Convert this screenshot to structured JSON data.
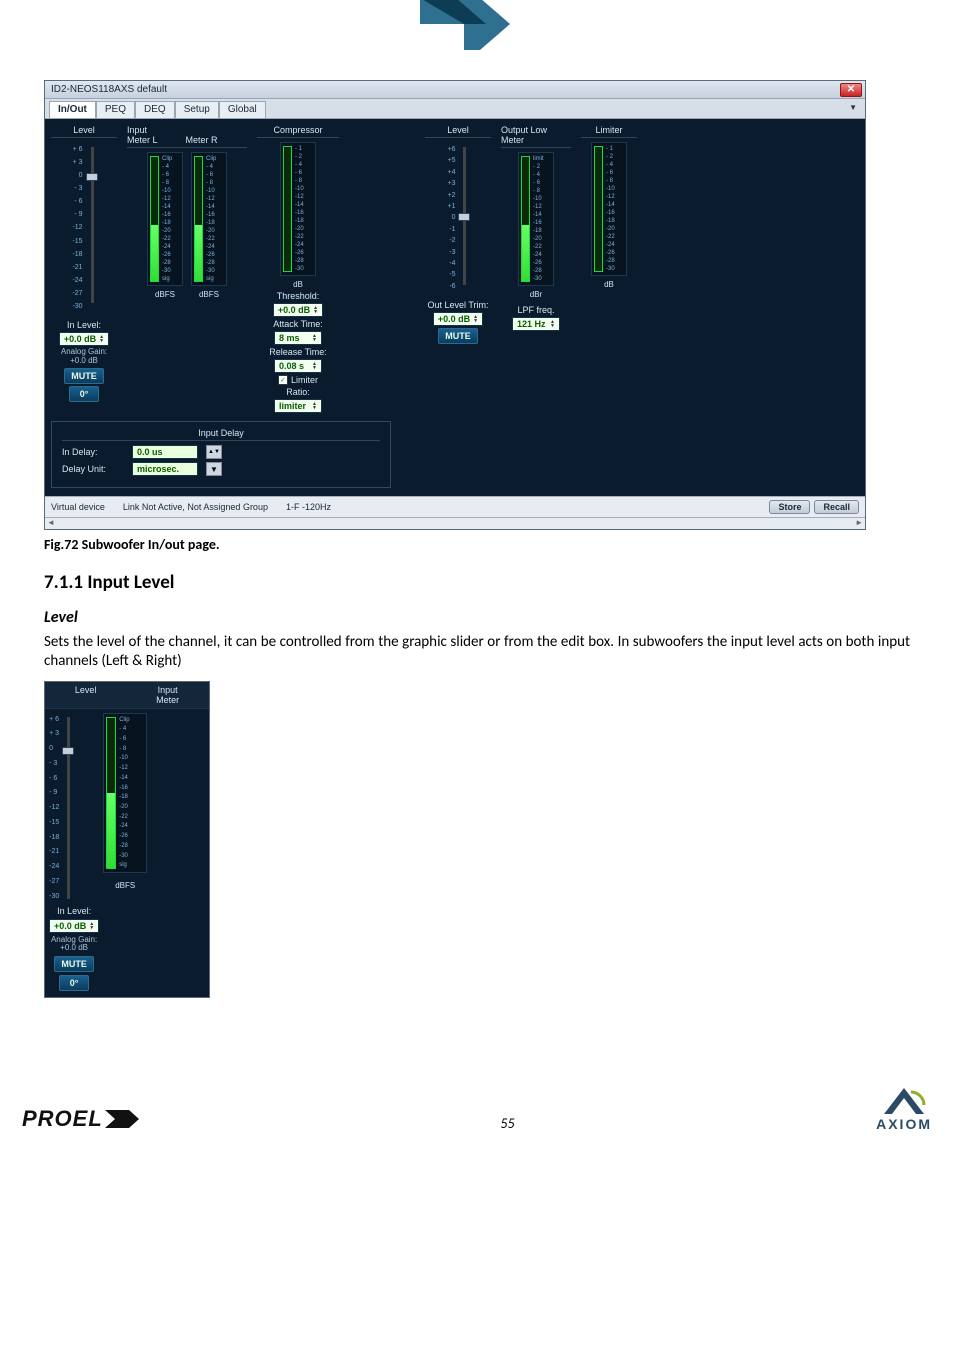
{
  "windowTitle": "ID2-NEOS118AXS default",
  "tabs": [
    "In/Out",
    "PEQ",
    "DEQ",
    "Setup",
    "Global"
  ],
  "activeTab": "In/Out",
  "input": {
    "sectionHeaders": {
      "level": "Level",
      "meter": "Input",
      "meterL": "Meter L",
      "meterR": "Meter R",
      "compressor": "Compressor"
    },
    "levelScale": [
      "+ 6",
      "+ 3",
      "0",
      "- 3",
      "- 6",
      "- 9",
      "-12",
      "-15",
      "-18",
      "-21",
      "-24",
      "-27",
      "-30"
    ],
    "meterScale": [
      "Clip",
      "- 4",
      "- 6",
      "- 8",
      "-10",
      "-12",
      "-14",
      "-16",
      "-18",
      "-20",
      "-22",
      "-24",
      "-26",
      "-28",
      "-30",
      "sig"
    ],
    "meterUnit": "dBFS",
    "compScale": [
      "- 1",
      "- 2",
      "- 4",
      "- 6",
      "- 8",
      "-10",
      "-12",
      "-14",
      "-16",
      "-18",
      "-20",
      "-22",
      "-24",
      "-26",
      "-28",
      "-30"
    ],
    "compUnit": "dB",
    "inLevelLbl": "In Level:",
    "inLevelVal": "+0.0 dB",
    "analogGainLbl": "Analog Gain:",
    "analogGainVal": "+0.0 dB",
    "muteBtn": "MUTE",
    "phaseBtn": "0°",
    "compressor": {
      "thLbl": "Threshold:",
      "thVal": "+0.0 dB",
      "atLbl": "Attack Time:",
      "atVal": "8 ms",
      "rlLbl": "Release Time:",
      "rlVal": "0.08 s",
      "limChk": "Limiter",
      "limChecked": true,
      "raLbl": "Ratio:",
      "raVal": "limiter"
    }
  },
  "inputDelay": {
    "title": "Input Delay",
    "inDelayLbl": "In Delay:",
    "inDelayVal": "0.0 us",
    "unitLbl": "Delay Unit:",
    "unitVal": "microsec."
  },
  "output": {
    "sectionHeaders": {
      "level": "Level",
      "meter": "Output Low",
      "meterSub": "Meter",
      "limiter": "Limiter"
    },
    "levelScale": [
      "+6",
      "+5",
      "+4",
      "+3",
      "+2",
      "+1",
      "0",
      "-1",
      "-2",
      "-3",
      "-4",
      "-5",
      "-6"
    ],
    "meterScale": [
      "limit",
      "- 2",
      "- 4",
      "- 6",
      "- 8",
      "-10",
      "-12",
      "-14",
      "-16",
      "-18",
      "-20",
      "-22",
      "-24",
      "-26",
      "-28",
      "-30"
    ],
    "meterUnit": "dBr",
    "limScale": [
      "- 1",
      "- 2",
      "- 4",
      "- 6",
      "- 8",
      "-10",
      "-12",
      "-14",
      "-16",
      "-18",
      "-20",
      "-22",
      "-24",
      "-26",
      "-28",
      "-30"
    ],
    "limUnit": "dB",
    "outTrimLbl": "Out Level Trim:",
    "outTrimVal": "+0.0 dB",
    "muteBtn": "MUTE",
    "lpfLbl": "LPF freq.",
    "lpfVal": "121 Hz"
  },
  "status": {
    "device": "Virtual device",
    "link": "Link Not Active,  Not Assigned Group",
    "filter": "1-F -120Hz",
    "storeBtn": "Store",
    "recallBtn": "Recall"
  },
  "caption": "Fig.72 Subwoofer  In/out page.",
  "heading": "7.1.1   Input Level",
  "subheading": "Level",
  "paragraph": "Sets the level of the channel, it can be controlled from the graphic slider or from the edit box. In subwoofers the input level acts on both input channels (Left & Right)",
  "mini": {
    "hdrLevel": "Level",
    "hdrMeter": "Input\nMeter",
    "unit": "dBFS"
  },
  "pageNumber": "55",
  "logoProel": "PROEL",
  "logoAxiom": "AXIOM"
}
